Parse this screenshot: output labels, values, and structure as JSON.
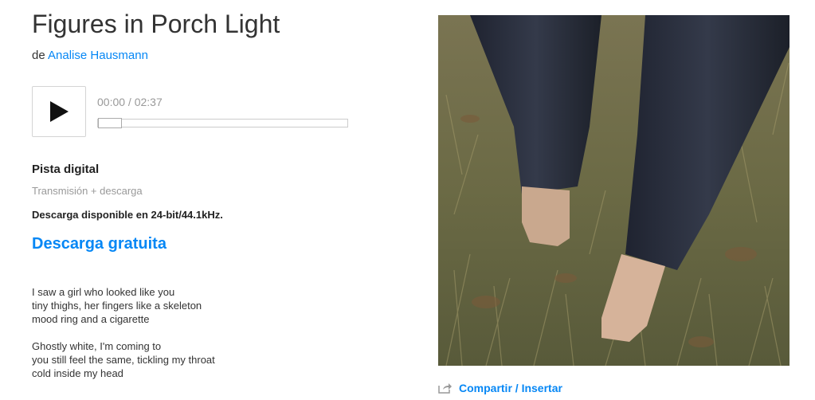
{
  "track": {
    "title": "Figures in Porch Light",
    "by_prefix": "de",
    "artist": "Analise Hausmann"
  },
  "player": {
    "time": "00:00 / 02:37",
    "progress_fraction": 0.0
  },
  "purchase": {
    "format": "Pista digital",
    "format_sub": "Transmisión + descarga",
    "hires_note": "Descarga disponible en 24-bit/44.1kHz.",
    "free_download": "Descarga gratuita"
  },
  "lyrics": {
    "stanza1": [
      "I saw a girl who looked like you",
      "tiny thighs, her fingers like a skeleton",
      "mood ring and a cigarette"
    ],
    "stanza2": [
      "Ghostly white, I'm coming to",
      "you still feel the same, tickling my throat",
      "cold inside my head"
    ]
  },
  "share": {
    "label": "Compartir / Insertar"
  },
  "colors": {
    "link": "#0687f5"
  }
}
